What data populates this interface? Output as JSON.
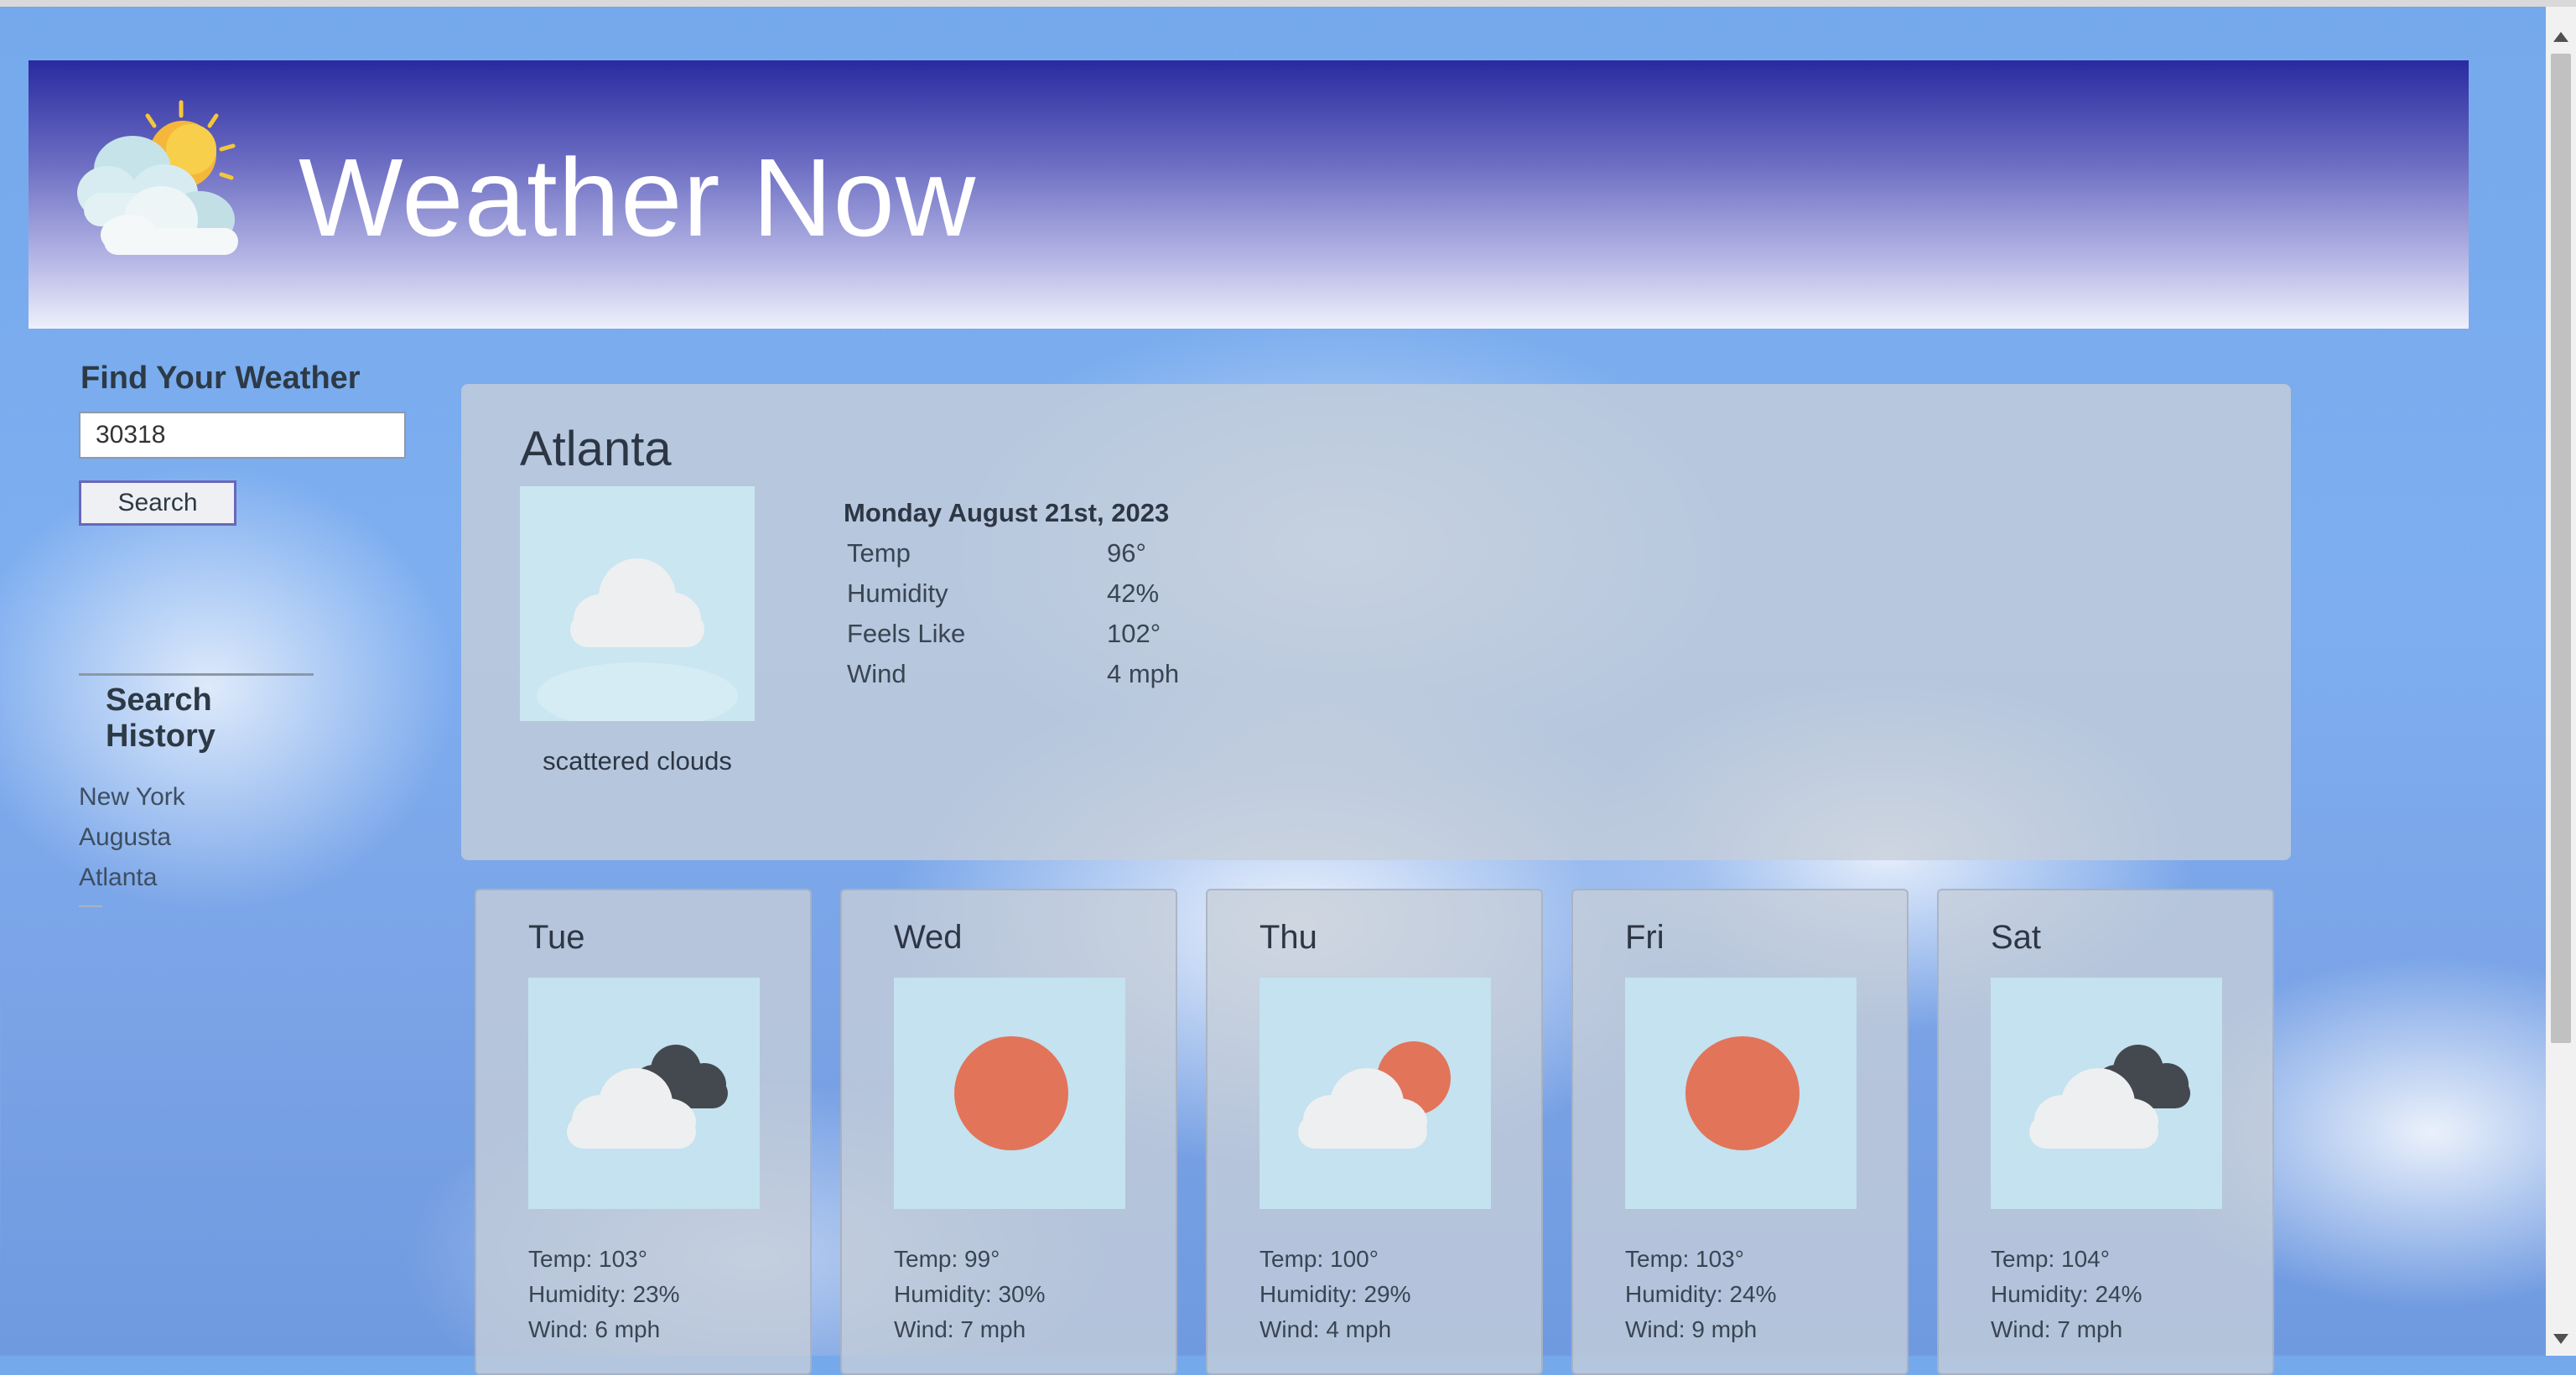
{
  "app": {
    "title": "Weather Now"
  },
  "search": {
    "label": "Find Your Weather",
    "value": "30318",
    "button": "Search"
  },
  "history": {
    "title": "Search History",
    "items": [
      "New York",
      "Augusta",
      "Atlanta"
    ]
  },
  "current": {
    "city": "Atlanta",
    "date": "Monday August 21st, 2023",
    "description": "scattered clouds",
    "icon": "scattered-clouds-icon",
    "stats": [
      {
        "label": "Temp",
        "value": "96°"
      },
      {
        "label": "Humidity",
        "value": "42%"
      },
      {
        "label": "Feels Like",
        "value": "102°"
      },
      {
        "label": "Wind",
        "value": "4 mph"
      }
    ]
  },
  "forecast": [
    {
      "day": "Tue",
      "icon": "cloud-dark-cloud-icon",
      "temp": "Temp: 103°",
      "humidity": "Humidity: 23%",
      "wind": "Wind: 6 mph"
    },
    {
      "day": "Wed",
      "icon": "sun-icon",
      "temp": "Temp: 99°",
      "humidity": "Humidity: 30%",
      "wind": "Wind: 7 mph"
    },
    {
      "day": "Thu",
      "icon": "cloud-sun-icon",
      "temp": "Temp: 100°",
      "humidity": "Humidity: 29%",
      "wind": "Wind: 4 mph"
    },
    {
      "day": "Fri",
      "icon": "sun-icon",
      "temp": "Temp: 103°",
      "humidity": "Humidity: 24%",
      "wind": "Wind: 9 mph"
    },
    {
      "day": "Sat",
      "icon": "cloud-dark-cloud-icon",
      "temp": "Temp: 104°",
      "humidity": "Humidity: 24%",
      "wind": "Wind: 7 mph"
    }
  ],
  "colors": {
    "sun": "#e2745a",
    "dark_cloud": "#44484f",
    "light_cloud": "#eef0f2",
    "header_top": "#2a2aa0"
  }
}
